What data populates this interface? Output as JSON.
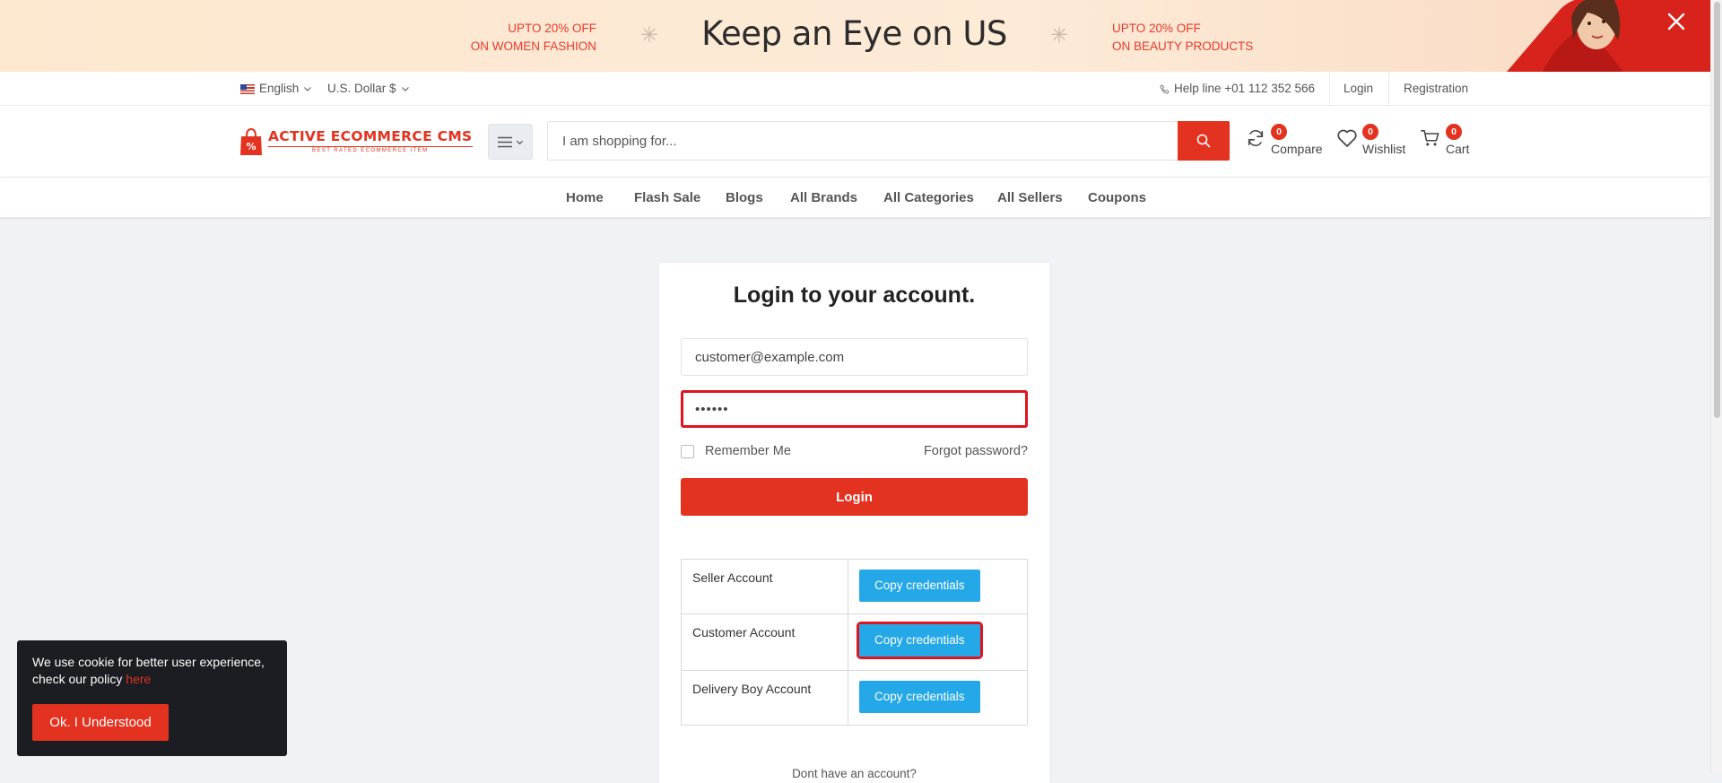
{
  "promo": {
    "left_line1": "UPTO 20% OFF",
    "left_line2": "ON WOMEN FASHION",
    "title": "Keep an Eye on US",
    "right_line1": "UPTO 20% OFF",
    "right_line2": "ON BEAUTY PRODUCTS",
    "close_icon": "close-icon"
  },
  "topbar": {
    "language": "English",
    "currency": "U.S. Dollar $",
    "helpline": "Help line +01 112 352 566",
    "login": "Login",
    "registration": "Registration"
  },
  "header": {
    "logo_name": "ACTIVE ECOMMERCE CMS",
    "logo_tagline": "BEST RATED ECOMMERCE ITEM",
    "search_placeholder": "I am shopping for...",
    "compare": {
      "label": "Compare",
      "count": "0"
    },
    "wishlist": {
      "label": "Wishlist",
      "count": "0"
    },
    "cart": {
      "label": "Cart",
      "count": "0"
    }
  },
  "nav": {
    "items": [
      "Home",
      "Flash Sale",
      "Blogs",
      "All Brands",
      "All Categories",
      "All Sellers",
      "Coupons"
    ]
  },
  "login": {
    "title": "Login to your account.",
    "email_value": "customer@example.com",
    "password_value": "••••••",
    "remember_label": "Remember Me",
    "forgot_label": "Forgot password?",
    "login_button": "Login",
    "credentials": [
      {
        "account": "Seller Account",
        "button": "Copy credentials"
      },
      {
        "account": "Customer Account",
        "button": "Copy credentials"
      },
      {
        "account": "Delivery Boy Account",
        "button": "Copy credentials"
      }
    ],
    "no_account": "Dont have an account?"
  },
  "cookie": {
    "text": "We use cookie for better user experience, check our policy",
    "link": "here",
    "button": "Ok. I Understood"
  },
  "colors": {
    "brand_red": "#e3321f",
    "copy_blue": "#25a8e8",
    "highlight_red": "#e0141e",
    "page_bg": "#f1f2f6"
  }
}
